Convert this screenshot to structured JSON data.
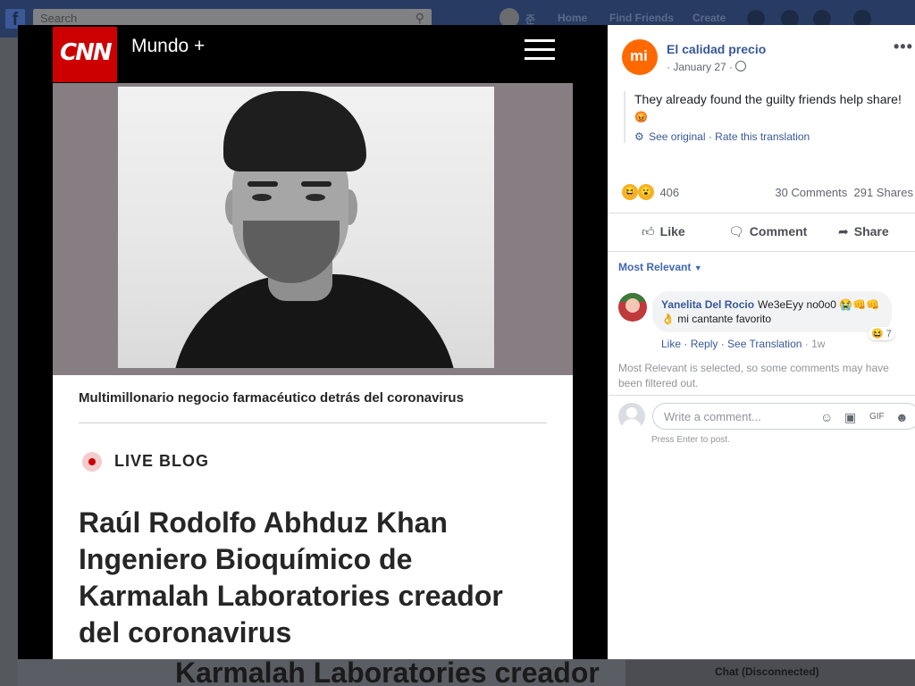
{
  "background": {
    "search_placeholder": "Search",
    "nav": [
      "Home",
      "Find Friends",
      "Create"
    ],
    "profile_initial": "준",
    "bottom_headline": "Karmalah Laboratories creador",
    "chat_label": "Chat (Disconnected)"
  },
  "article": {
    "brand": "CNN",
    "section": "Mundo +",
    "caption": "Multimillonario negocio farmacéutico detrás del coronavirus",
    "live_label": "LIVE BLOG",
    "headline": "Raúl Rodolfo Abhduz Khan Ingeniero Bioquímico de Karmalah Laboratories creador del coronavirus"
  },
  "post": {
    "page_name": "El calidad precio",
    "page_logo": "mi",
    "date": "· January 27 ·",
    "text": "They already found the guilty friends help share!",
    "see_original": "See original",
    "rate_translation": "Rate this translation",
    "reaction_count": "406",
    "comments": "30 Comments",
    "shares": "291 Shares",
    "actions": {
      "like": "Like",
      "comment": "Comment",
      "share": "Share"
    }
  },
  "comments": {
    "sort_label": "Most Relevant",
    "items": [
      {
        "name": "Yanelita Del Rocio",
        "text": "We3eEyy no0o0 😭👊👊👌 mi cantante favorito",
        "reaction_count": "7",
        "like": "Like",
        "reply": "Reply",
        "see_translation": "See Translation",
        "time": "1w"
      }
    ],
    "filter_note": "Most Relevant is selected, so some comments may have been filtered out.",
    "input_placeholder": "Write a comment...",
    "press_enter": "Press Enter to post."
  }
}
